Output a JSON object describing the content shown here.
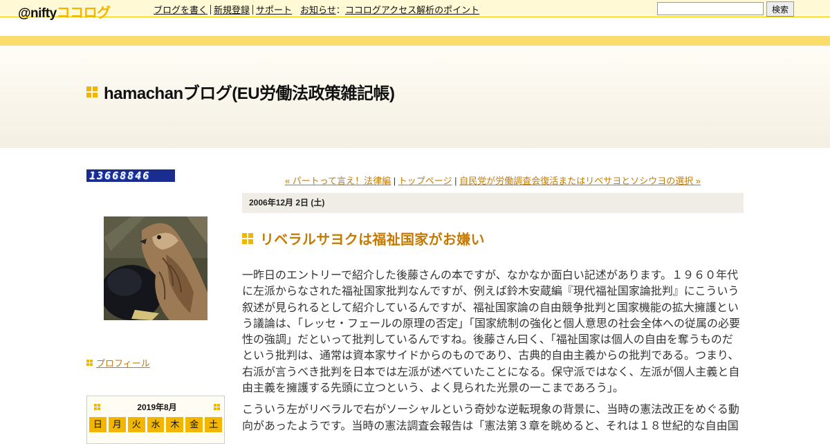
{
  "header": {
    "logo_prefix": "@nifty",
    "logo_brand": "ココログ",
    "nav": [
      {
        "label": "ブログを書く"
      },
      {
        "label": "新規登録"
      },
      {
        "label": "サポート"
      }
    ],
    "news_label": "お知らせ",
    "news_colon": "：",
    "news_link": "ココログアクセス解析のポイント",
    "search": {
      "value": "",
      "placeholder": "",
      "button_label": "検索"
    },
    "accent_color": "#f2b600"
  },
  "blog": {
    "title": "hamachanブログ(EU労働法政策雑記帳)"
  },
  "sidebar": {
    "counter_value": "13668846",
    "avatar_icon": "hawk-photo",
    "profile_label": "プロフィール",
    "calendar": {
      "month": "2019年8月",
      "weekdays": [
        "日",
        "月",
        "火",
        "水",
        "木",
        "金",
        "土"
      ]
    }
  },
  "entry": {
    "prev_link": "« パートって言え！法律編",
    "sep1": "|",
    "top_link": "トップページ",
    "sep2": "|",
    "next_link": "自民党が労働調査会復活またはリベサヨとソシウヨの選択 »",
    "date": "2006年12月 2日 (土)",
    "title": "リベラルサヨクは福祉国家がお嫌い",
    "paragraphs": [
      "一昨日のエントリーで紹介した後藤さんの本ですが、なかなか面白い記述があります。１９６０年代に左派からなされた福祉国家批判なんですが、例えば鈴木安蔵編『現代福祉国家論批判』にこういう叙述が見られるとして紹介しているんですが、福祉国家論の自由競争批判と国家機能の拡大擁護という議論は、「レッセ・フェールの原理の否定」「国家統制の強化と個人意思の社会全体への従属の必要性の強調」だといって批判しているんですね。後藤さん曰く、「福祉国家は個人の自由を奪うものだという批判は、通常は資本家サイドからのものであり、古典的自由主義からの批判である。つまり、右派が言うべき批判を日本では左派が述べていたことになる。保守派ではなく、左派が個人主義と自由主義を擁護する先頭に立つという、よく見られた光景の一こまであろう」。",
      "こういう左がリベラルで右がソーシャルという奇妙な逆転現象の背景に、当時の憲法改正をめぐる動向があったようです。当時の憲法調査会報告は「憲法第３章を眺めると、それは１８世紀的な自由国"
    ]
  }
}
